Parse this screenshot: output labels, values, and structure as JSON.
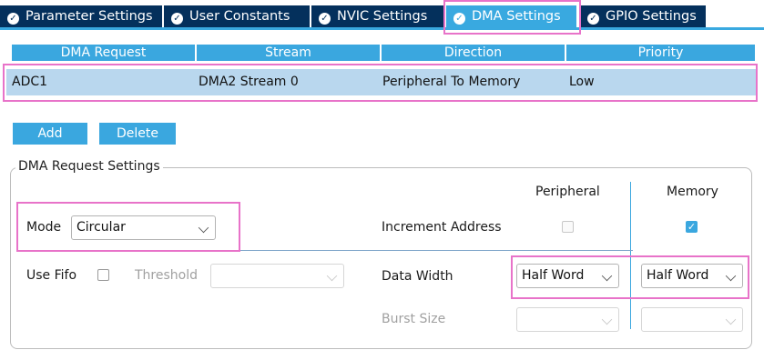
{
  "tabs": [
    {
      "label": "Parameter Settings",
      "active": false
    },
    {
      "label": "User Constants",
      "active": false
    },
    {
      "label": "NVIC Settings",
      "active": false
    },
    {
      "label": "DMA Settings",
      "active": true
    },
    {
      "label": "GPIO Settings",
      "active": false
    }
  ],
  "table": {
    "headers": [
      "DMA Request",
      "Stream",
      "Direction",
      "Priority"
    ],
    "rows": [
      [
        "ADC1",
        "DMA2 Stream 0",
        "Peripheral To Memory",
        "Low"
      ]
    ]
  },
  "buttons": {
    "add": "Add",
    "delete": "Delete"
  },
  "settings": {
    "group_title": "DMA Request Settings",
    "col_peripheral": "Peripheral",
    "col_memory": "Memory",
    "mode_label": "Mode",
    "mode_value": "Circular",
    "increment_address_label": "Increment Address",
    "increment_peripheral_checked": false,
    "increment_memory_checked": true,
    "use_fifo_label": "Use Fifo",
    "use_fifo_checked": false,
    "threshold_label": "Threshold",
    "threshold_value": "",
    "data_width_label": "Data Width",
    "data_width_peripheral": "Half Word",
    "data_width_memory": "Half Word",
    "burst_size_label": "Burst Size",
    "burst_peripheral": "",
    "burst_memory": ""
  },
  "colors": {
    "tab_bg": "#04305c",
    "accent": "#39a9e0",
    "row_selected": "#b9d7ee",
    "highlight": "#e873c9"
  }
}
